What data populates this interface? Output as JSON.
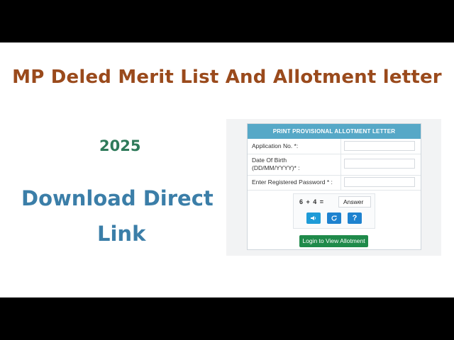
{
  "headline": "MP Deled Merit List And Allotment letter",
  "year": "2025",
  "download_line1": "Download Direct",
  "download_line2": "Link",
  "form": {
    "header": "PRINT PROVISIONAL ALLOTMENT LETTER",
    "application_label": "Application No. *:",
    "dob_label_line1": "Date Of Birth",
    "dob_label_line2": "(DD/MM/YYYY)* :",
    "password_label": "Enter Registered Password * :",
    "captcha_question": "6 + 4 =",
    "answer_value": "Answer",
    "help_label": "?",
    "login_button": "Login to View Allotment"
  },
  "icons": {
    "audio": "speaker-icon",
    "refresh": "refresh-icon",
    "help": "help-icon"
  },
  "colors": {
    "headline": "#9a4a1c",
    "year": "#2e7a5a",
    "download": "#3b7ea8",
    "form_header": "#56a8c7",
    "login_button": "#1f8a4a"
  }
}
